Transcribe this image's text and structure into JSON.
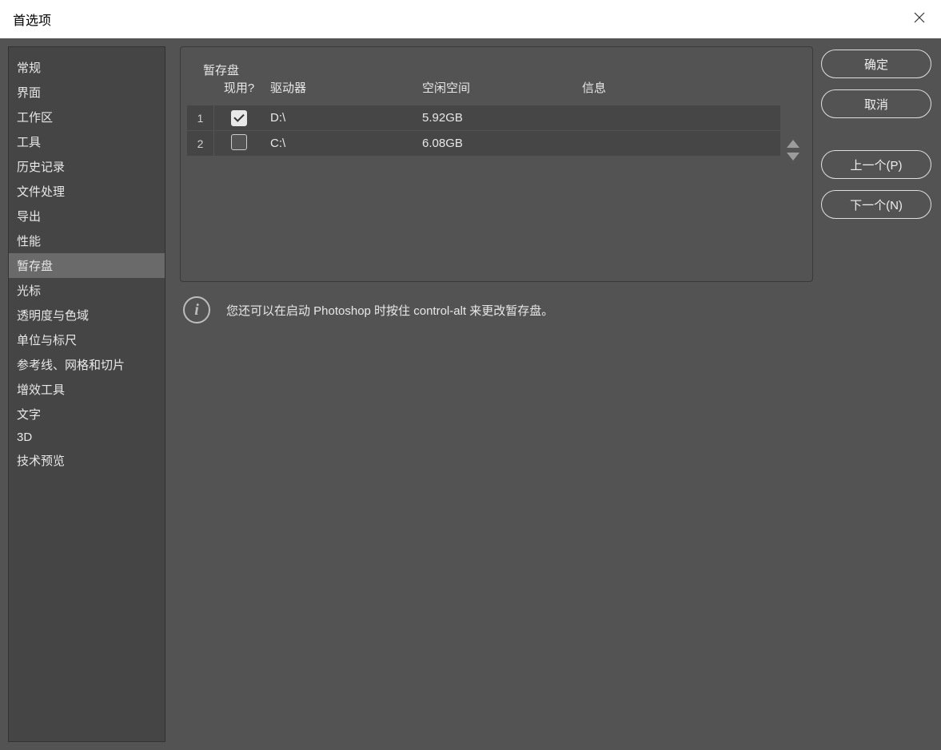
{
  "window": {
    "title": "首选项"
  },
  "sidebar": {
    "items": [
      "常规",
      "界面",
      "工作区",
      "工具",
      "历史记录",
      "文件处理",
      "导出",
      "性能",
      "暂存盘",
      "光标",
      "透明度与色域",
      "单位与标尺",
      "参考线、网格和切片",
      "增效工具",
      "文字",
      "3D",
      "技术预览"
    ],
    "activeIndex": 8
  },
  "panel": {
    "legend": "暂存盘",
    "headers": {
      "active": "现用?",
      "drive": "驱动器",
      "free": "空闲空间",
      "info": "信息"
    },
    "rows": [
      {
        "num": "1",
        "active": true,
        "drive": "D:\\",
        "free": "5.92GB",
        "info": ""
      },
      {
        "num": "2",
        "active": false,
        "drive": "C:\\",
        "free": "6.08GB",
        "info": ""
      }
    ]
  },
  "hint": {
    "text": "您还可以在启动 Photoshop 时按住 control-alt 来更改暂存盘。"
  },
  "actions": {
    "ok": "确定",
    "cancel": "取消",
    "prev": "上一个(P)",
    "next": "下一个(N)"
  }
}
